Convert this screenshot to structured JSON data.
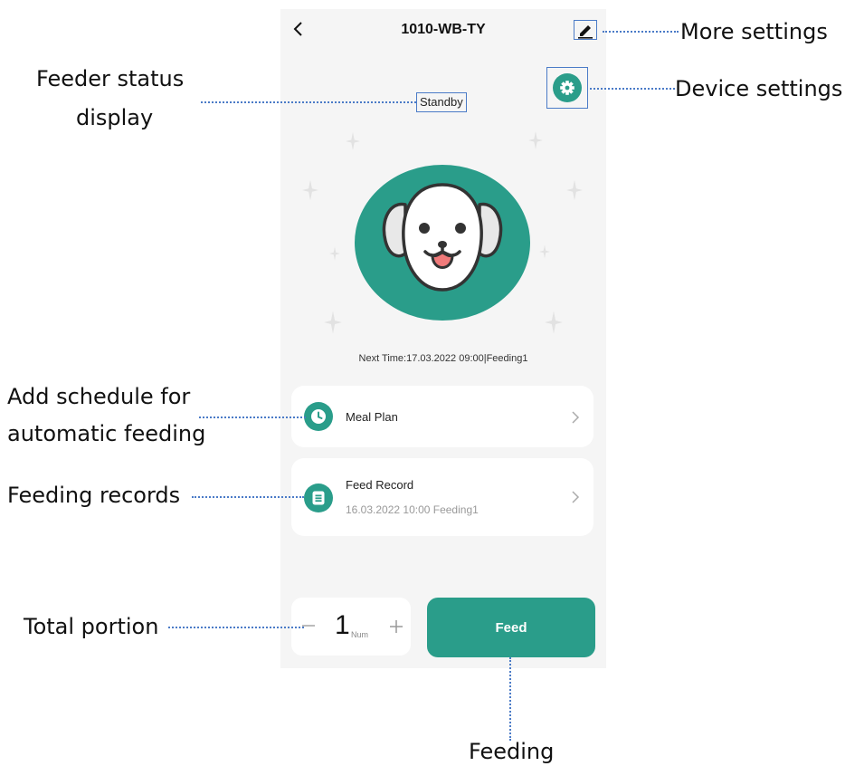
{
  "header": {
    "title": "1010-WB-TY",
    "back_icon": "chevron-left-icon",
    "edit_icon": "edit-pencil-icon"
  },
  "status": {
    "label": "Standby"
  },
  "settings": {
    "icon": "gear-icon"
  },
  "pet_image": "dog-face-icon",
  "next_time": "Next Time:17.03.2022 09:00|Feeding1",
  "meal_plan": {
    "label": "Meal Plan",
    "icon": "clock-icon"
  },
  "feed_record": {
    "label": "Feed Record",
    "sub": "16.03.2022 10:00 Feeding1",
    "icon": "document-icon"
  },
  "portion": {
    "value": "1",
    "unit": "Num"
  },
  "feed_button": {
    "label": "Feed"
  },
  "annotations": {
    "more_settings": "More settings",
    "device_settings": "Device settings",
    "status_line1": "Feeder status",
    "status_line2": "display",
    "schedule_line1": "Add schedule for",
    "schedule_line2": "automatic feeding",
    "records": "Feeding records",
    "total_portion": "Total portion",
    "feeding": "Feeding"
  },
  "colors": {
    "accent": "#2a9d8a",
    "annotation_line": "#4b7bc7",
    "background": "#f5f5f5"
  }
}
